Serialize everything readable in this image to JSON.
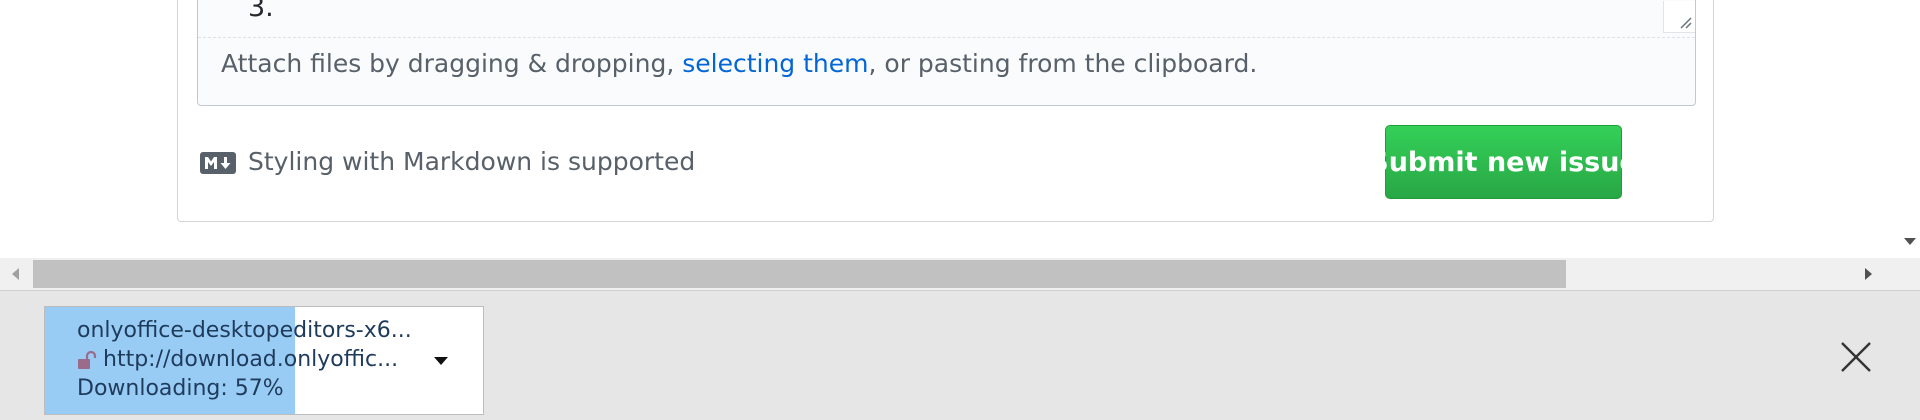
{
  "editor": {
    "list_number": "3.",
    "attach_prefix": "Attach files by dragging & dropping, ",
    "attach_link": "selecting them",
    "attach_suffix": ", or pasting from the clipboard."
  },
  "footer": {
    "markdown_note": "Styling with Markdown is supported",
    "submit_label": "Submit new issue"
  },
  "scrollbar": {
    "horizontal_left_arrow": "scroll-left-icon",
    "horizontal_right_arrow": "scroll-right-icon",
    "vertical_down_arrow": "scroll-down-icon"
  },
  "download_bar": {
    "filename": "onlyoffice-desktopeditors-x6...",
    "url": "http://download.onlyoffic...",
    "status": "Downloading: 57%",
    "progress": 0.57,
    "icons": [
      "unlocked-lock-icon",
      "chevron-down-icon",
      "close-icon"
    ]
  },
  "colors": {
    "submit_green": "#2ea44f",
    "link_blue": "#0366d6",
    "progress_blue": "#99ccf5"
  }
}
